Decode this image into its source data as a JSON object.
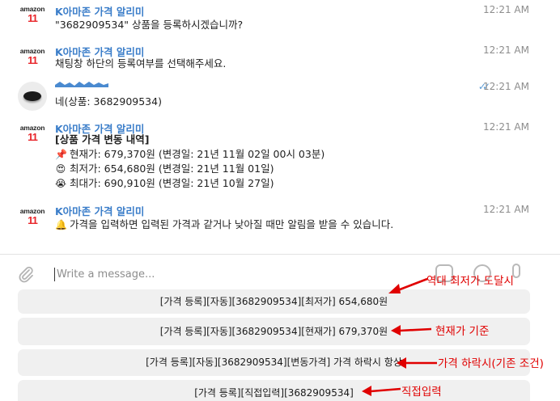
{
  "messages": [
    {
      "sender": "K아마존 가격 알리미",
      "time": "12:21 AM",
      "lines": [
        "\"3682909534\" 상품을 등록하시겠습니까?"
      ]
    },
    {
      "sender": "K아마존 가격 알리미",
      "time": "12:21 AM",
      "lines": [
        "채팅창 하단의 등록여부를 선택해주세요."
      ]
    },
    {
      "time": "12:21 AM",
      "status": "read",
      "lines": [
        "네(상품: 3682909534)"
      ]
    },
    {
      "sender": "K아마존 가격 알리미",
      "time": "12:21 AM",
      "heading": "[상품 가격 변동 내역]",
      "price_lines": [
        {
          "icon": "pushpin-icon",
          "glyph": "📌",
          "text": "현재가: 679,370원 (변경일: 21년 11월 02일 00시 03분)"
        },
        {
          "icon": "heart-eyes-icon",
          "glyph": "😍",
          "text": "최저가: 654,680원 (변경일: 21년 11월 01일)"
        },
        {
          "icon": "crying-face-icon",
          "glyph": "😭",
          "text": "최대가: 690,910원 (변경일: 21년 10월 27일)"
        }
      ]
    },
    {
      "sender": "K아마존 가격 알리미",
      "time": "12:21 AM",
      "icon": "bell-icon",
      "glyph": "🔔",
      "lines": [
        "가격을 입력하면 입력된 가격과 같거나 낮아질 때만 알림을 받을 수 있습니다."
      ]
    }
  ],
  "logo": {
    "word": "amazon",
    "mark": "11"
  },
  "composer": {
    "placeholder": "Write a message..."
  },
  "keyboard": [
    {
      "label": "[가격 등록][자동][3682909534][최저가] 654,680원"
    },
    {
      "label": "[가격 등록][자동][3682909534][현재가] 679,370원"
    },
    {
      "label": "[가격 등록][자동][3682909534][변동가격] 가격 하락시 항상"
    },
    {
      "label": "[가격 등록][직접입력][3682909534]"
    }
  ],
  "annotations": [
    {
      "text": "역대 최저가 도달시"
    },
    {
      "text": "현재가 기준"
    },
    {
      "text": "가격 하락시(기존 조건)"
    },
    {
      "text": "직접입력"
    }
  ],
  "colors": {
    "sender": "#3a7dc9",
    "annotation": "#e00000",
    "button_bg": "#f0f0f0",
    "logo_red": "#e8262b"
  }
}
